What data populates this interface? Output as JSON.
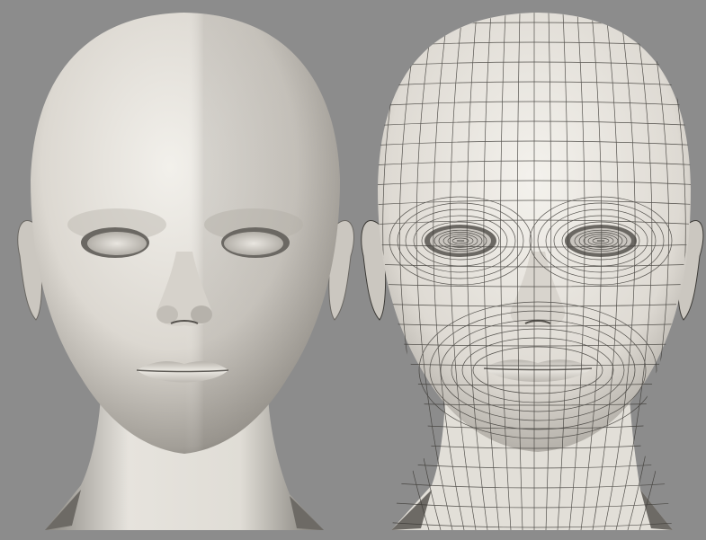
{
  "scene": {
    "background_color": "#8c8c8c",
    "skin_light": "#efede8",
    "skin_mid": "#c9c5be",
    "skin_dark": "#6f6c67",
    "wire_color": "#3c3a36",
    "views": [
      {
        "id": "smooth-shaded",
        "wireframe": false
      },
      {
        "id": "wireframe-shaded",
        "wireframe": true
      }
    ]
  }
}
